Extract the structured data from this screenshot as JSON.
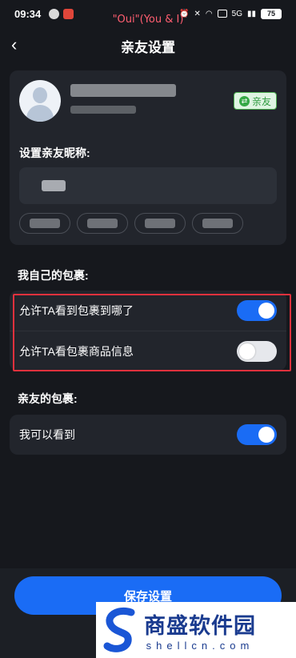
{
  "status_bar": {
    "time": "09:34",
    "battery": "75",
    "network": "5G"
  },
  "caption": "\"Oui\"(You & I)",
  "header": {
    "title": "亲友设置"
  },
  "profile": {
    "relation_badge": "亲友",
    "nickname_label": "设置亲友昵称:"
  },
  "my_package": {
    "title": "我自己的包裹:",
    "options": [
      {
        "label": "允许TA看到包裹到哪了",
        "enabled": true
      },
      {
        "label": "允许TA看包裹商品信息",
        "enabled": false
      }
    ]
  },
  "friend_package": {
    "title": "亲友的包裹:",
    "options": [
      {
        "label": "我可以看到",
        "enabled": true
      }
    ]
  },
  "save_button": "保存设置",
  "watermark": {
    "title": "商盛软件园",
    "url": "shellcn.com"
  },
  "colors": {
    "accent": "#1a6cf5",
    "highlight": "#e0313d",
    "background": "#16181d",
    "card": "#22252c"
  }
}
